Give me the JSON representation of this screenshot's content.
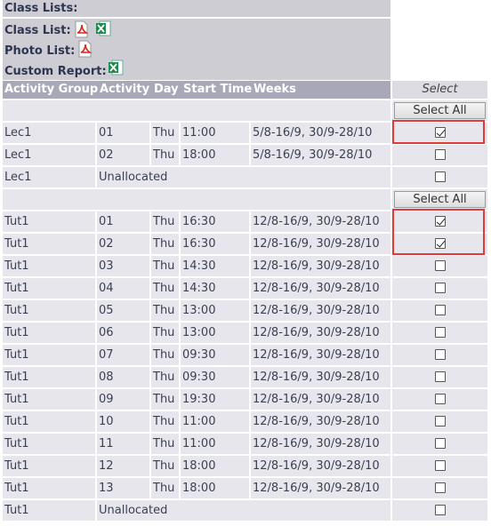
{
  "header": {
    "class_lists": "Class Lists:",
    "class_list": "Class List:",
    "photo_list": "Photo List:",
    "custom_report": "Custom Report:",
    "icons": {
      "pdf": "pdf-file-icon",
      "excel": "excel-file-icon"
    }
  },
  "columns": [
    "Activity Group",
    "Activity",
    "Day",
    "Start Time",
    "Weeks"
  ],
  "select_header": "Select",
  "select_all_label": "Select All",
  "groups": [
    {
      "rows": [
        {
          "group": "Lec1",
          "activity": "01",
          "day": "Thu",
          "start": "11:00",
          "weeks": "5/8-16/9, 30/9-28/10",
          "checked": true
        },
        {
          "group": "Lec1",
          "activity": "02",
          "day": "Thu",
          "start": "18:00",
          "weeks": "5/8-16/9, 30/9-28/10",
          "checked": false
        },
        {
          "group": "Lec1",
          "activity": "Unallocated",
          "day": "",
          "start": "",
          "weeks": "",
          "checked": false
        }
      ]
    },
    {
      "rows": [
        {
          "group": "Tut1",
          "activity": "01",
          "day": "Thu",
          "start": "16:30",
          "weeks": "12/8-16/9, 30/9-28/10",
          "checked": true
        },
        {
          "group": "Tut1",
          "activity": "02",
          "day": "Thu",
          "start": "16:30",
          "weeks": "12/8-16/9, 30/9-28/10",
          "checked": true
        },
        {
          "group": "Tut1",
          "activity": "03",
          "day": "Thu",
          "start": "14:30",
          "weeks": "12/8-16/9, 30/9-28/10",
          "checked": false
        },
        {
          "group": "Tut1",
          "activity": "04",
          "day": "Thu",
          "start": "14:30",
          "weeks": "12/8-16/9, 30/9-28/10",
          "checked": false
        },
        {
          "group": "Tut1",
          "activity": "05",
          "day": "Thu",
          "start": "13:00",
          "weeks": "12/8-16/9, 30/9-28/10",
          "checked": false
        },
        {
          "group": "Tut1",
          "activity": "06",
          "day": "Thu",
          "start": "13:00",
          "weeks": "12/8-16/9, 30/9-28/10",
          "checked": false
        },
        {
          "group": "Tut1",
          "activity": "07",
          "day": "Thu",
          "start": "09:30",
          "weeks": "12/8-16/9, 30/9-28/10",
          "checked": false
        },
        {
          "group": "Tut1",
          "activity": "08",
          "day": "Thu",
          "start": "09:30",
          "weeks": "12/8-16/9, 30/9-28/10",
          "checked": false
        },
        {
          "group": "Tut1",
          "activity": "09",
          "day": "Thu",
          "start": "19:30",
          "weeks": "12/8-16/9, 30/9-28/10",
          "checked": false
        },
        {
          "group": "Tut1",
          "activity": "10",
          "day": "Thu",
          "start": "11:00",
          "weeks": "12/8-16/9, 30/9-28/10",
          "checked": false
        },
        {
          "group": "Tut1",
          "activity": "11",
          "day": "Thu",
          "start": "11:00",
          "weeks": "12/8-16/9, 30/9-28/10",
          "checked": false
        },
        {
          "group": "Tut1",
          "activity": "12",
          "day": "Thu",
          "start": "18:00",
          "weeks": "12/8-16/9, 30/9-28/10",
          "checked": false
        },
        {
          "group": "Tut1",
          "activity": "13",
          "day": "Thu",
          "start": "18:00",
          "weeks": "12/8-16/9, 30/9-28/10",
          "checked": false
        },
        {
          "group": "Tut1",
          "activity": "Unallocated",
          "day": "",
          "start": "",
          "weeks": "",
          "checked": false
        }
      ]
    }
  ],
  "highlight_color": "#e23a3a"
}
